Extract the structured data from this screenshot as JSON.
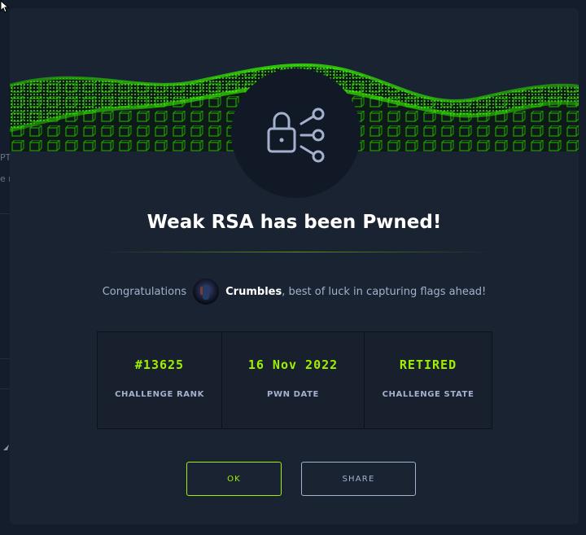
{
  "background": {
    "fragment_1": "PT",
    "fragment_2": "e r"
  },
  "modal": {
    "badge_icon": "lock-share-icon",
    "title": "Weak RSA has been Pwned!",
    "congrats_prefix": "Congratulations",
    "username": "Crumbles",
    "congrats_suffix": ", best of luck in capturing flags ahead!",
    "stats": [
      {
        "value": "#13625",
        "label": "CHALLENGE RANK"
      },
      {
        "value": "16 Nov 2022",
        "label": "PWN DATE"
      },
      {
        "value": "RETIRED",
        "label": "CHALLENGE STATE"
      }
    ],
    "ok_label": "OK",
    "share_label": "SHARE"
  },
  "colors": {
    "accent": "#9fef00",
    "modal_bg": "#1a2332",
    "page_bg": "#141d2b",
    "muted_text": "#a4b1cd"
  }
}
